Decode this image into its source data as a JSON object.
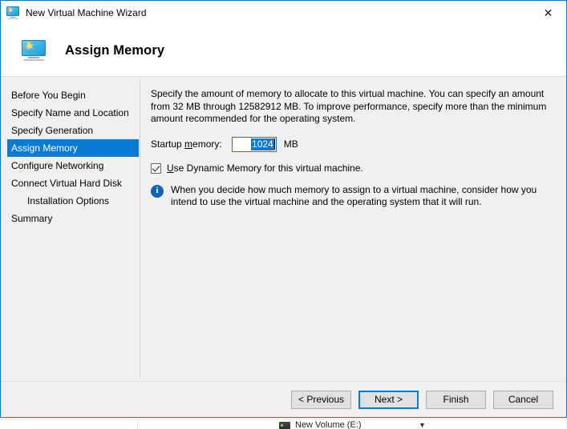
{
  "window": {
    "title": "New Virtual Machine Wizard",
    "icon": "virtual-machine-icon",
    "close_label": "✕"
  },
  "header": {
    "icon": "virtual-machine-icon",
    "title": "Assign Memory"
  },
  "sidebar": {
    "items": [
      {
        "label": "Before You Begin",
        "selected": false,
        "indent": false
      },
      {
        "label": "Specify Name and Location",
        "selected": false,
        "indent": false
      },
      {
        "label": "Specify Generation",
        "selected": false,
        "indent": false
      },
      {
        "label": "Assign Memory",
        "selected": true,
        "indent": false
      },
      {
        "label": "Configure Networking",
        "selected": false,
        "indent": false
      },
      {
        "label": "Connect Virtual Hard Disk",
        "selected": false,
        "indent": false
      },
      {
        "label": "Installation Options",
        "selected": false,
        "indent": true
      },
      {
        "label": "Summary",
        "selected": false,
        "indent": false
      }
    ]
  },
  "main": {
    "intro": "Specify the amount of memory to allocate to this virtual machine. You can specify an amount from 32 MB through 12582912 MB. To improve performance, specify more than the minimum amount recommended for the operating system.",
    "startup_memory": {
      "label_prefix": "Startup ",
      "label_accel": "m",
      "label_suffix": "emory:",
      "value": "1024",
      "unit": "MB"
    },
    "dynamic_memory": {
      "checked": true,
      "label_accel": "U",
      "label_suffix": "se Dynamic Memory for this virtual machine."
    },
    "note": {
      "icon": "info-icon",
      "glyph": "i",
      "text": "When you decide how much memory to assign to a virtual machine, consider how you intend to use the virtual machine and the operating system that it will run."
    }
  },
  "footer": {
    "buttons": [
      {
        "label": "< Previous",
        "focused": false
      },
      {
        "label": "Next >",
        "focused": true
      },
      {
        "label": "Finish",
        "focused": false
      },
      {
        "label": "Cancel",
        "focused": false
      }
    ]
  },
  "background": {
    "row_label": "New Volume (E:)"
  },
  "colors": {
    "accent": "#0a7bd4",
    "dialog_border": "#0078d7",
    "info": "#1364b4",
    "body_bg": "#f0f0f0",
    "button_bg": "#e1e1e1"
  }
}
